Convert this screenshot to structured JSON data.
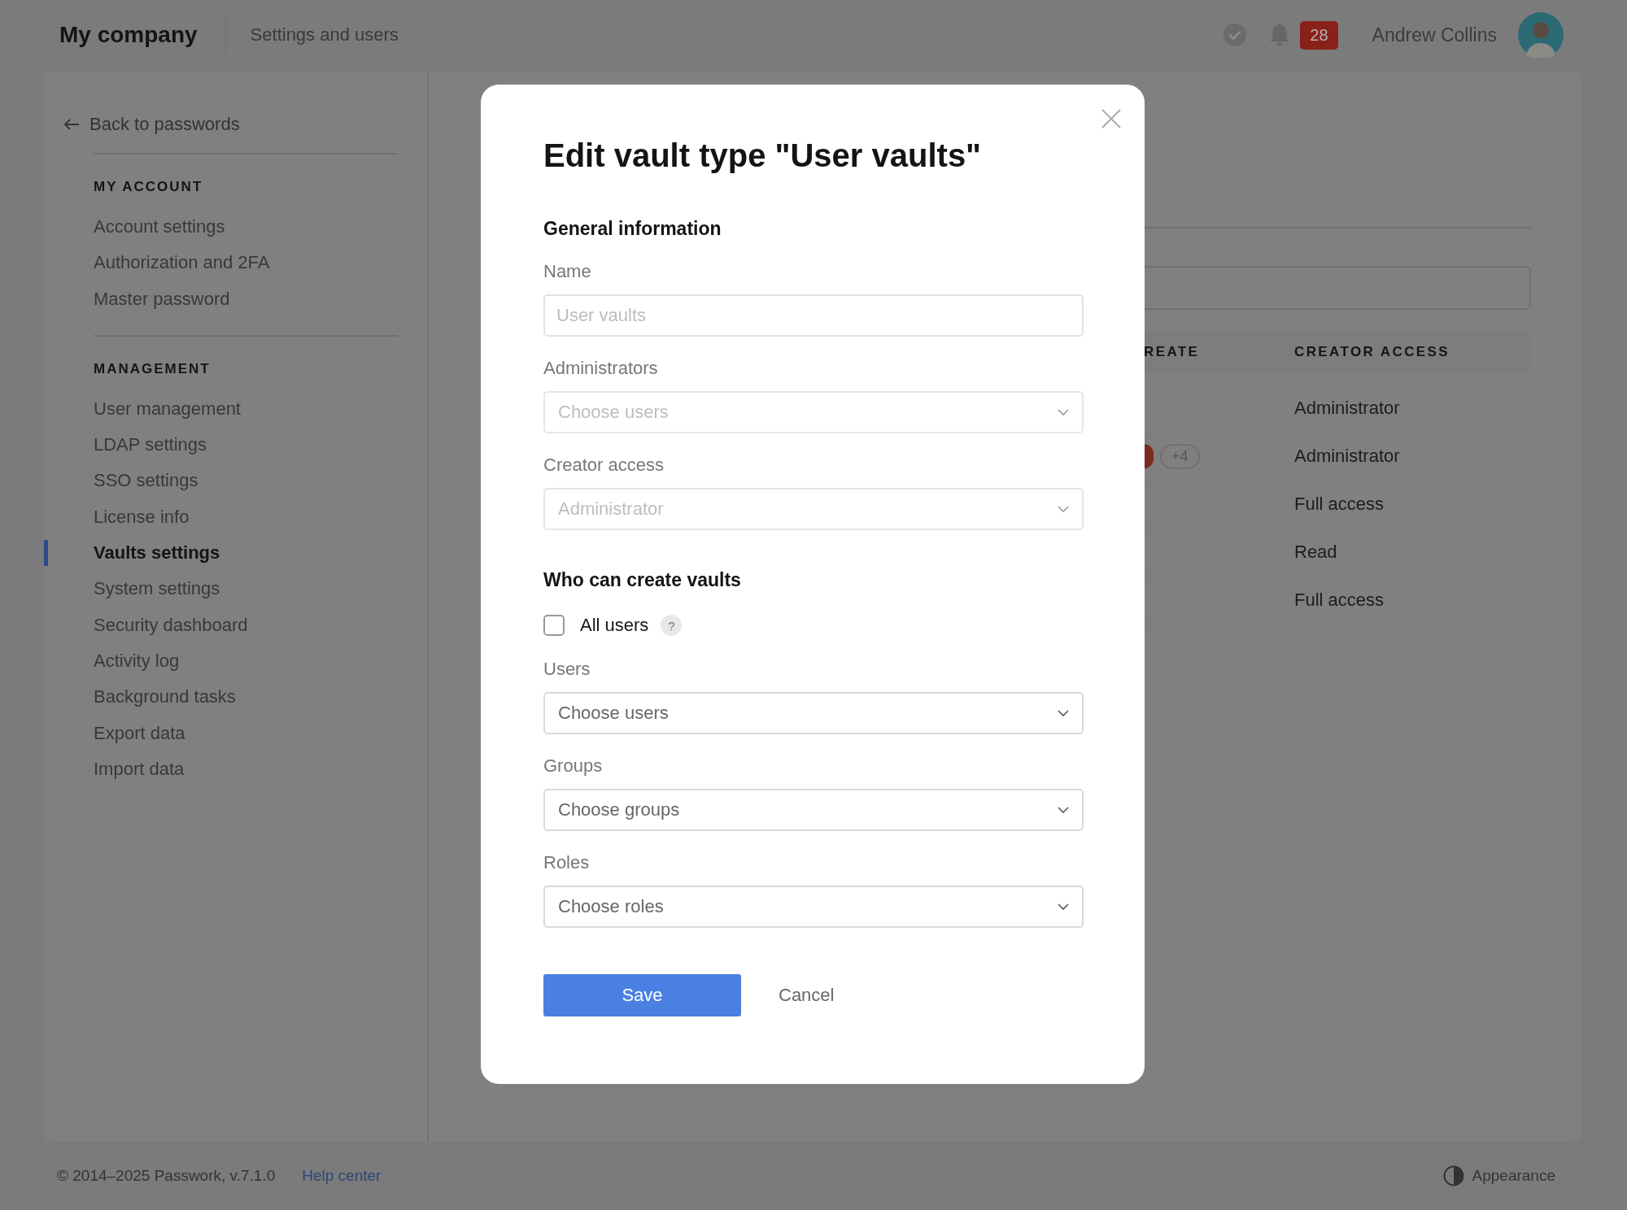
{
  "header": {
    "logo": "My company",
    "section": "Settings and users",
    "notifications": "28",
    "user": "Andrew Collins"
  },
  "sidebar": {
    "back": "Back to passwords",
    "groups": [
      {
        "title": "MY ACCOUNT",
        "items": [
          {
            "label": "Account settings",
            "selected": false
          },
          {
            "label": "Authorization and 2FA",
            "selected": false
          },
          {
            "label": "Master password",
            "selected": false
          }
        ]
      },
      {
        "title": "MANAGEMENT",
        "items": [
          {
            "label": "User management",
            "selected": false
          },
          {
            "label": "LDAP settings",
            "selected": false
          },
          {
            "label": "SSO settings",
            "selected": false
          },
          {
            "label": "License info",
            "selected": false
          },
          {
            "label": "Vaults settings",
            "selected": true
          },
          {
            "label": "System settings",
            "selected": false
          },
          {
            "label": "Security dashboard",
            "selected": false
          },
          {
            "label": "Activity log",
            "selected": false
          },
          {
            "label": "Background tasks",
            "selected": false
          },
          {
            "label": "Export data",
            "selected": false
          },
          {
            "label": "Import data",
            "selected": false
          }
        ]
      }
    ]
  },
  "table": {
    "columns": [
      "REATE",
      "CREATOR ACCESS"
    ],
    "rows": [
      {
        "creator_access": "Administrator"
      },
      {
        "more_count": "+4",
        "creator_access": "Administrator"
      },
      {
        "creator_access": "Full access"
      },
      {
        "creator_access": "Read"
      },
      {
        "creator_access": "Full access"
      }
    ]
  },
  "dialog": {
    "title": "Edit vault type \"User vaults\"",
    "sections": [
      {
        "heading": "General information",
        "fields": [
          {
            "kind": "input",
            "label": "Name",
            "value": "User vaults",
            "disabled": true
          },
          {
            "kind": "select",
            "label": "Administrators",
            "placeholder": "Choose users",
            "disabled": true
          },
          {
            "kind": "select",
            "label": "Creator access",
            "value": "Administrator",
            "disabled": true
          }
        ]
      },
      {
        "heading": "Who can create vaults",
        "fields": [
          {
            "kind": "checkbox",
            "label": "All users",
            "checked": false,
            "help": "?"
          },
          {
            "kind": "select",
            "label": "Users",
            "placeholder": "Choose users",
            "disabled": false
          },
          {
            "kind": "select",
            "label": "Groups",
            "placeholder": "Choose groups",
            "disabled": false
          },
          {
            "kind": "select",
            "label": "Roles",
            "placeholder": "Choose roles",
            "disabled": false
          }
        ]
      }
    ],
    "buttons": [
      {
        "label": "Save",
        "kind": "primary"
      },
      {
        "label": "Cancel",
        "kind": "secondary"
      }
    ]
  },
  "footer": {
    "copyright": "© 2014–2025 Passwork, v.7.1.0",
    "help_link": "Help center",
    "appearance": "Appearance"
  }
}
